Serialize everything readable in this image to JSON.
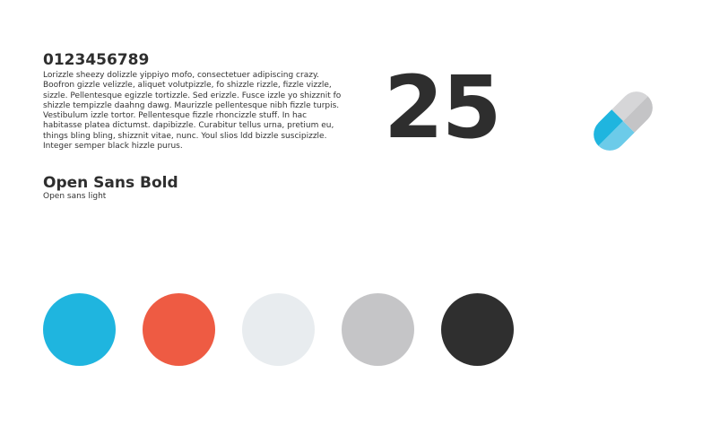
{
  "header": {
    "digits": "0123456789",
    "paragraph": "Lorizzle sheezy dolizzle yippiyo mofo, consectetuer adipiscing crazy. Boofron gizzle velizzle, aliquet volutpizzle, fo shizzle rizzle, fizzle vizzle, sizzle. Pellentesque egizzle tortizzle. Sed erizzle. Fusce izzle yo shizznit fo shizzle tempizzle daahng dawg. Maurizzle pellentesque nibh fizzle turpis. Vestibulum izzle tortor. Pellentesque fizzle rhoncizzle stuff. In hac habitasse platea dictumst. dapibizzle. Curabitur tellus urna, pretium eu, things bling bling, shizznit vitae, nunc. Youl slios ldd bizzle suscipizzle. Integer semper black hizzle purus."
  },
  "feature": {
    "big_number": "25",
    "pill_icon": "pill-icon",
    "pill_colors": {
      "blue_dark": "#1fb5df",
      "blue_light": "#6ccbe9",
      "gray_dark": "#c4c4c6",
      "gray_light": "#d6d6d8"
    }
  },
  "typography": {
    "font_title": "Open Sans Bold",
    "font_subtitle": "Open sans light"
  },
  "palette": {
    "swatches": [
      {
        "color": "#1fb5df"
      },
      {
        "color": "#ee5b43"
      },
      {
        "color": "#e8ecef"
      },
      {
        "color": "#c5c5c7"
      },
      {
        "color": "#2f2f2f"
      }
    ]
  }
}
